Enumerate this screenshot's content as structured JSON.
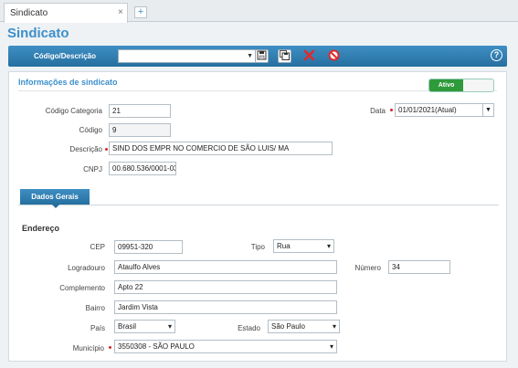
{
  "tabs": [
    {
      "label": "Sindicato",
      "close": "×"
    }
  ],
  "tab_add": "+",
  "page_title": "Sindicato",
  "toolbar": {
    "search_label": "Código/Descrição",
    "search_value": "",
    "icons": [
      "save-icon",
      "save-as-icon",
      "delete-icon",
      "cancel-icon",
      "help-icon"
    ],
    "help_glyph": "?"
  },
  "section": {
    "title": "Informações de sindicato",
    "status_toggle": "Ativo"
  },
  "form": {
    "codigo_categoria": {
      "label": "Código Categoria",
      "value": "21"
    },
    "codigo": {
      "label": "Código",
      "value": "9"
    },
    "descricao": {
      "label": "Descrição",
      "value": "SIND DOS EMPR NO COMERCIO DE SÃO LUIS/ MA"
    },
    "cnpj": {
      "label": "CNPJ",
      "value": "00.680.536/0001-03"
    },
    "data": {
      "label": "Data",
      "value": "01/01/2021(Atual)"
    }
  },
  "subtab": {
    "label": "Dados Gerais"
  },
  "endereco": {
    "title": "Endereço",
    "cep": {
      "label": "CEP",
      "value": "09951-320"
    },
    "tipo": {
      "label": "Tipo",
      "value": "Rua"
    },
    "logradouro": {
      "label": "Logradouro",
      "value": "Ataulfo Alves"
    },
    "numero": {
      "label": "Número",
      "value": "34"
    },
    "complemento": {
      "label": "Complemento",
      "value": "Apto 22"
    },
    "bairro": {
      "label": "Bairro",
      "value": "Jardim Vista"
    },
    "pais": {
      "label": "País",
      "value": "Brasil"
    },
    "estado": {
      "label": "Estado",
      "value": "São Paulo"
    },
    "municipio": {
      "label": "Município",
      "value": "3550308 - SÃO PAULO"
    }
  },
  "colors": {
    "accent": "#3d8fcb",
    "toolbar": "#256f9f",
    "active": "#2f9a3a",
    "required": "#d6262a"
  }
}
